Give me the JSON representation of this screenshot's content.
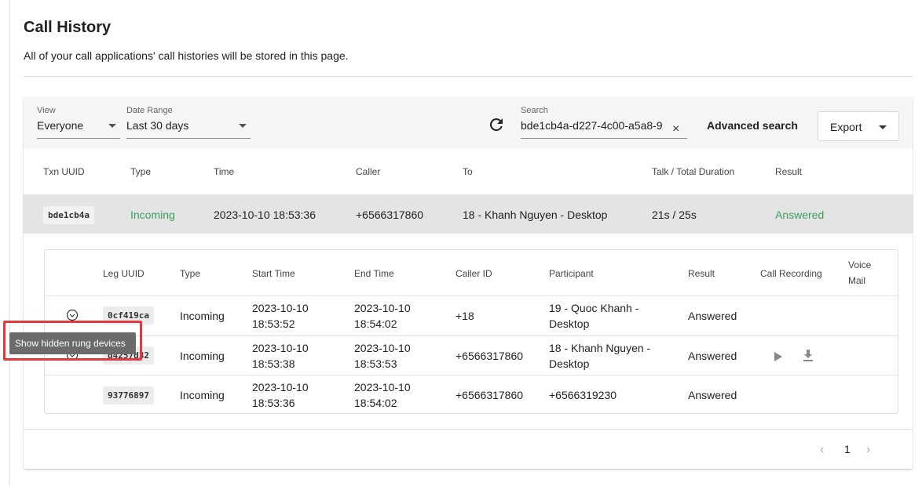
{
  "page": {
    "title": "Call History",
    "subtitle": "All of your call applications' call histories will be stored in this page."
  },
  "filters": {
    "view_label": "View",
    "view_value": "Everyone",
    "date_label": "Date Range",
    "date_value": "Last 30 days",
    "search_label": "Search",
    "search_value": "bde1cb4a-d227-4c00-a5a8-9",
    "clear_glyph": "×",
    "advanced_search": "Advanced search",
    "export_label": "Export"
  },
  "table": {
    "headers": {
      "txn": "Txn UUID",
      "type": "Type",
      "time": "Time",
      "caller": "Caller",
      "to": "To",
      "duration": "Talk / Total Duration",
      "result": "Result"
    },
    "row": {
      "txn": "bde1cb4a",
      "type": "Incoming",
      "time": "2023-10-10 18:53:36",
      "caller": "+6566317860",
      "to": "18 - Khanh Nguyen  - Desktop",
      "duration": "21s / 25s",
      "result": "Answered"
    }
  },
  "legs": {
    "headers": {
      "leg": "Leg UUID",
      "type": "Type",
      "start": "Start Time",
      "end": "End Time",
      "caller_id": "Caller ID",
      "participant": "Participant",
      "result": "Result",
      "recording": "Call Recording",
      "voicemail_1": "Voice",
      "voicemail_2": "Mail"
    },
    "rows": [
      {
        "leg": "0cf419ca",
        "type": "Incoming",
        "start_1": "2023-10-10",
        "start_2": "18:53:52",
        "end_1": "2023-10-10",
        "end_2": "18:54:02",
        "caller_id": "+18",
        "participant_1": "19 - Quoc Khanh  -",
        "participant_2": "Desktop",
        "result": "Answered"
      },
      {
        "leg": "d4257d32",
        "type": "Incoming",
        "start_1": "2023-10-10",
        "start_2": "18:53:38",
        "end_1": "2023-10-10",
        "end_2": "18:53:53",
        "caller_id": "+6566317860",
        "participant_1": "18 - Khanh Nguyen  -",
        "participant_2": "Desktop",
        "result": "Answered"
      },
      {
        "leg": "93776897",
        "type": "Incoming",
        "start_1": "2023-10-10",
        "start_2": "18:53:36",
        "end_1": "2023-10-10",
        "end_2": "18:54:02",
        "caller_id": "+6566317860",
        "participant_1": "+6566319230",
        "participant_2": "",
        "result": "Answered"
      }
    ]
  },
  "pagination": {
    "prev": "‹",
    "page": "1",
    "next": "›"
  },
  "tooltip": {
    "text": "Show hidden rung devices"
  },
  "icons": {
    "refresh": "refresh-icon",
    "expand": "chevron-circle-down-icon",
    "play": "play-icon",
    "download": "download-icon"
  },
  "colors": {
    "accent_green": "#3aa05c",
    "highlight_red": "#e0393e",
    "tooltip_bg": "#6b6b6b"
  }
}
